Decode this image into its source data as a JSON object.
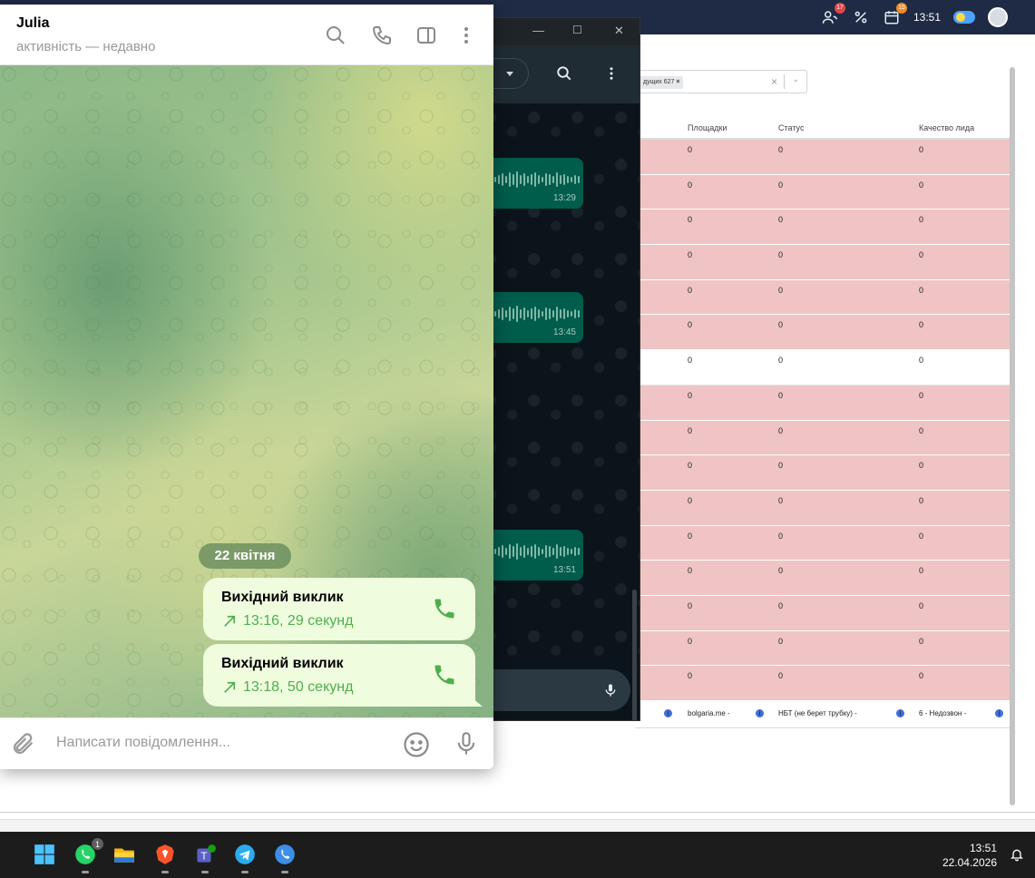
{
  "crm": {
    "top": {
      "contacts_badge": "17",
      "calendar_badge": "15",
      "time": "13:51"
    },
    "filter": {
      "chip_label": "дущих 627",
      "chip_remove": "×",
      "clear": "×",
      "arrow": "⌄"
    },
    "table": {
      "headers": [
        "Площадки",
        "Статус",
        "Качество лида"
      ],
      "rows": [
        {
          "style": "pink",
          "cells": [
            "0",
            "0",
            "0"
          ]
        },
        {
          "style": "pink",
          "cells": [
            "0",
            "0",
            "0"
          ]
        },
        {
          "style": "pink",
          "cells": [
            "0",
            "0",
            "0"
          ]
        },
        {
          "style": "pink",
          "cells": [
            "0",
            "0",
            "0"
          ]
        },
        {
          "style": "pink",
          "cells": [
            "0",
            "0",
            "0"
          ]
        },
        {
          "style": "pink",
          "cells": [
            "0",
            "0",
            "0"
          ]
        },
        {
          "style": "white",
          "cells": [
            "0",
            "0",
            "0"
          ]
        },
        {
          "style": "pink",
          "cells": [
            "0",
            "0",
            "0"
          ]
        },
        {
          "style": "pink",
          "cells": [
            "0",
            "0",
            "0"
          ]
        },
        {
          "style": "pink",
          "cells": [
            "0",
            "0",
            "0"
          ]
        },
        {
          "style": "pink",
          "cells": [
            "0",
            "0",
            "0"
          ]
        },
        {
          "style": "pink",
          "cells": [
            "0",
            "0",
            "0"
          ]
        },
        {
          "style": "pink",
          "cells": [
            "0",
            "0",
            "0"
          ]
        },
        {
          "style": "pink",
          "cells": [
            "0",
            "0",
            "0"
          ]
        },
        {
          "style": "pink",
          "cells": [
            "0",
            "0",
            "0"
          ]
        },
        {
          "style": "pink",
          "cells": [
            "0",
            "0",
            "0"
          ]
        }
      ],
      "summary": [
        "bolgaria.me -",
        "НБТ (не берет трубку) -",
        "6 - Недозвон -"
      ]
    }
  },
  "whatsapp": {
    "title_buttons": [
      "—",
      "☐",
      "✕"
    ],
    "voice_messages": [
      {
        "time": "13:29"
      },
      {
        "time": "13:45"
      },
      {
        "time": "13:51"
      }
    ]
  },
  "telegram": {
    "contact_name": "Julia",
    "contact_status": "активність — недавно",
    "date_separator": "22 квітня",
    "calls": [
      {
        "title": "Вихідний виклик",
        "info": "13:16, 29 секунд"
      },
      {
        "title": "Вихідний виклик",
        "info": "13:18, 50 секунд"
      }
    ],
    "composer_placeholder": "Написати повідомлення..."
  },
  "taskbar": {
    "whatsapp_badge": "1",
    "time": "13:51",
    "date": "22.04.2026"
  },
  "colors": {
    "telegram_accent": "#4fae4e",
    "outgoing_bubble": "#effdde",
    "crm_row_pink": "#f0c4c4",
    "whatsapp_bubble": "#005c4b"
  },
  "icons": {
    "telegram_header": [
      "search-icon",
      "phone-icon",
      "sidebar-toggle-icon",
      "more-vertical-icon"
    ],
    "telegram_composer": [
      "paperclip-icon",
      "emoji-icon",
      "microphone-icon"
    ],
    "taskbar": [
      "windows-start-icon",
      "whatsapp-icon",
      "file-explorer-icon",
      "brave-icon",
      "teams-icon",
      "telegram-icon",
      "phone-app-icon"
    ]
  }
}
